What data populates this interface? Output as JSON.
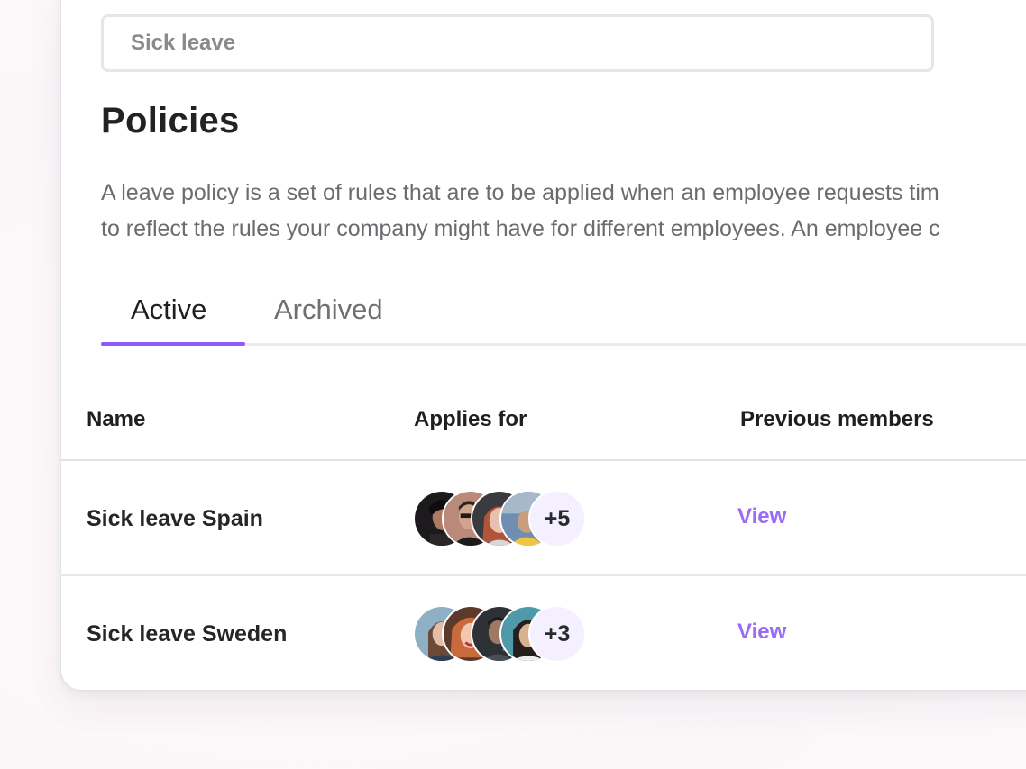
{
  "policy_name_input": {
    "value": "Sick leave"
  },
  "page": {
    "title": "Policies",
    "description_line1": "A leave policy is a set of rules that are to be applied when an employee requests tim",
    "description_line2": "to reflect the rules your company might have for different employees. An employee c"
  },
  "tabs": [
    {
      "label": "Active",
      "selected": true
    },
    {
      "label": "Archived",
      "selected": false
    }
  ],
  "table": {
    "columns": [
      "Name",
      "Applies for",
      "Previous members"
    ],
    "rows": [
      {
        "name": "Sick leave Spain",
        "avatar_icons": [
          "person-avatar",
          "person-avatar",
          "person-avatar",
          "person-avatar"
        ],
        "more_count": "+5",
        "action": "View"
      },
      {
        "name": "Sick leave Sweden",
        "avatar_icons": [
          "person-avatar",
          "person-avatar",
          "person-avatar",
          "person-avatar"
        ],
        "more_count": "+3",
        "action": "View"
      }
    ]
  },
  "colors": {
    "accent": "#8b5cf6",
    "link": "#9a6cf5",
    "more_badge_bg": "#f4f0ff"
  }
}
